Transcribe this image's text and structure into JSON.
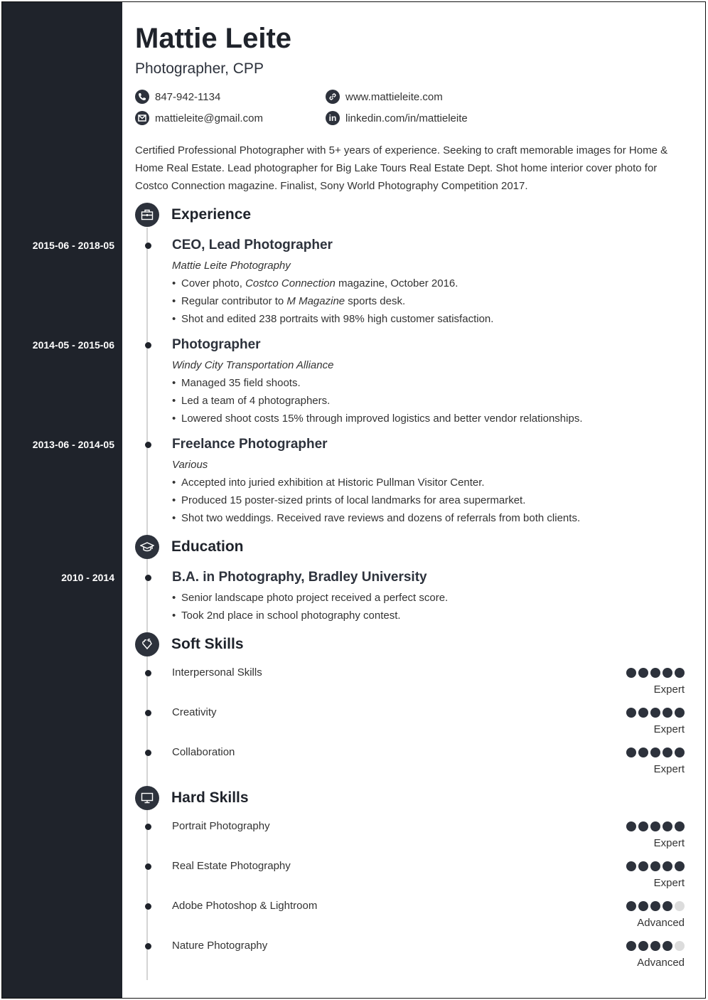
{
  "header": {
    "name": "Mattie Leite",
    "title": "Photographer, CPP"
  },
  "contacts": {
    "phone": {
      "icon": "phone-icon",
      "value": "847-942-1134"
    },
    "email": {
      "icon": "envelope-icon",
      "value": "mattieleite@gmail.com"
    },
    "website": {
      "icon": "link-icon",
      "value": "www.mattieleite.com"
    },
    "linkedin": {
      "icon": "linkedin-icon",
      "value": "linkedin.com/in/mattieleite"
    }
  },
  "summary": "Certified Professional Photographer with 5+ years of experience. Seeking to craft memorable images for Home & Home Real Estate. Lead photographer for Big Lake Tours Real Estate Dept. Shot home interior cover photo for Costco Connection magazine. Finalist, Sony World Photography Competition 2017.",
  "experience": {
    "title": "Experience",
    "icon": "briefcase-icon",
    "jobs": [
      {
        "dates": "2015-06 - 2018-05",
        "title": "CEO, Lead Photographer",
        "company": "Mattie Leite Photography",
        "bullets": [
          [
            "Cover photo, ",
            "Costco Connection",
            " magazine, October 2016."
          ],
          [
            "Regular contributor to ",
            "M Magazine",
            " sports desk."
          ],
          [
            "Shot and edited 238 portraits with 98% high customer satisfaction.",
            "",
            ""
          ]
        ]
      },
      {
        "dates": "2014-05 - 2015-06",
        "title": "Photographer",
        "company": "Windy City Transportation Alliance",
        "bullets": [
          [
            "Managed 35 field shoots.",
            "",
            ""
          ],
          [
            "Led a team of 4 photographers.",
            "",
            ""
          ],
          [
            "Lowered shoot costs 15% through improved logistics and better vendor relationships.",
            "",
            ""
          ]
        ]
      },
      {
        "dates": "2013-06 - 2014-05",
        "title": "Freelance Photographer",
        "company": "Various",
        "bullets": [
          [
            "Accepted into juried exhibition at Historic Pullman Visitor Center.",
            "",
            ""
          ],
          [
            "Produced 15 poster-sized prints of local landmarks for area supermarket.",
            "",
            ""
          ],
          [
            "Shot two weddings. Received rave reviews and dozens of referrals from both clients.",
            "",
            ""
          ]
        ]
      }
    ]
  },
  "education": {
    "title": "Education",
    "icon": "graduation-cap-icon",
    "items": [
      {
        "dates": "2010 - 2014",
        "title": "B.A. in Photography, Bradley University",
        "bullets": [
          "Senior landscape photo project received a perfect score.",
          "Took 2nd place in school photography contest."
        ]
      }
    ]
  },
  "soft_skills": {
    "title": "Soft Skills",
    "icon": "puzzle-hand-icon",
    "items": [
      {
        "name": "Interpersonal Skills",
        "rating": 5,
        "max": 5,
        "level": "Expert"
      },
      {
        "name": "Creativity",
        "rating": 5,
        "max": 5,
        "level": "Expert"
      },
      {
        "name": "Collaboration",
        "rating": 5,
        "max": 5,
        "level": "Expert"
      }
    ]
  },
  "hard_skills": {
    "title": "Hard Skills",
    "icon": "monitor-icon",
    "items": [
      {
        "name": "Portrait Photography",
        "rating": 5,
        "max": 5,
        "level": "Expert"
      },
      {
        "name": "Real Estate Photography",
        "rating": 5,
        "max": 5,
        "level": "Expert"
      },
      {
        "name": "Adobe Photoshop & Lightroom",
        "rating": 4,
        "max": 5,
        "level": "Advanced"
      },
      {
        "name": "Nature Photography",
        "rating": 4,
        "max": 5,
        "level": "Advanced"
      }
    ]
  },
  "colors": {
    "sidebar": "#1f232b",
    "accent": "#2d323c",
    "rating_off": "#dcdcdc",
    "timeline": "#d4d4d4"
  }
}
